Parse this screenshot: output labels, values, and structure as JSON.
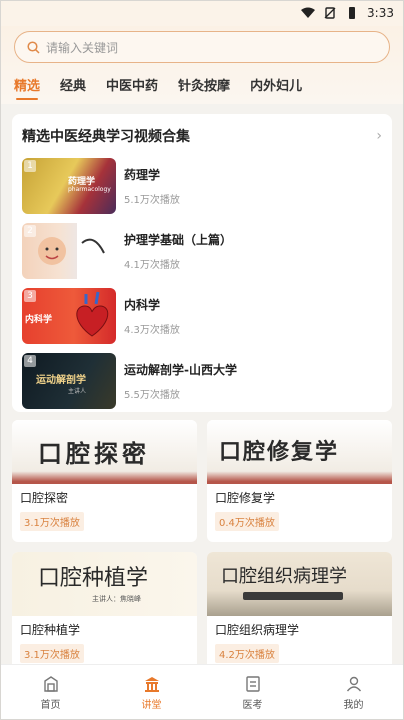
{
  "status_bar": {
    "time": "3:33"
  },
  "search": {
    "placeholder": "请输入关键词"
  },
  "tabs": [
    {
      "label": "精选",
      "active": true
    },
    {
      "label": "经典"
    },
    {
      "label": "中医中药"
    },
    {
      "label": "针灸按摩"
    },
    {
      "label": "内外妇儿"
    }
  ],
  "collection": {
    "title": "精选中医经典学习视频合集",
    "items": [
      {
        "rank": "1",
        "title": "药理学",
        "plays": "5.1万次播放",
        "thumb_text": "药理学",
        "thumb_sub": "pharmacology"
      },
      {
        "rank": "2",
        "title": "护理学基础（上篇）",
        "plays": "4.1万次播放"
      },
      {
        "rank": "3",
        "title": "内科学",
        "plays": "4.3万次播放",
        "thumb_text": "内科学"
      },
      {
        "rank": "4",
        "title": "运动解剖学-山西大学",
        "plays": "5.5万次播放",
        "thumb_text": "运动解剖学",
        "thumb_sub": "主讲人"
      }
    ]
  },
  "grid": [
    {
      "title": "口腔探密",
      "plays": "3.1万次播放",
      "thumb_text": "口腔探密"
    },
    {
      "title": "口腔修复学",
      "plays": "0.4万次播放",
      "thumb_text": "口腔修复学"
    },
    {
      "title": "口腔种植学",
      "plays": "3.1万次播放",
      "thumb_text": "口腔种植学",
      "thumb_sub": "主讲人：焦晓峰"
    },
    {
      "title": "口腔组织病理学",
      "plays": "4.2万次播放",
      "thumb_text": "口腔组织病理学"
    }
  ],
  "bottom_nav": [
    {
      "label": "首页",
      "icon": "home-icon"
    },
    {
      "label": "讲堂",
      "icon": "lecture-icon",
      "active": true
    },
    {
      "label": "医考",
      "icon": "exam-icon"
    },
    {
      "label": "我的",
      "icon": "profile-icon"
    }
  ],
  "colors": {
    "accent": "#e8792b",
    "search_border": "#e7b388"
  }
}
